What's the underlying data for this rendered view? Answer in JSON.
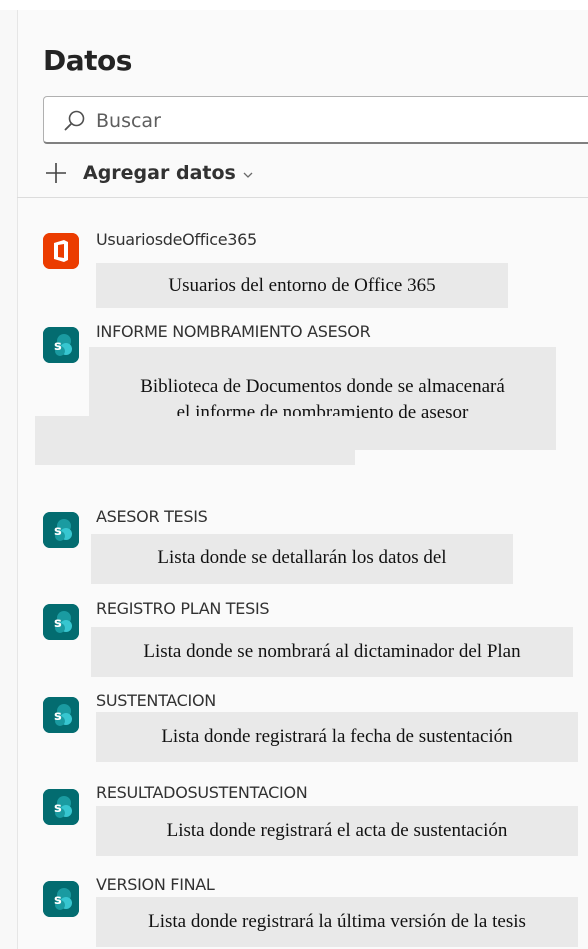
{
  "panel": {
    "title": "Datos",
    "search_placeholder": "Buscar",
    "add_label": "Agregar datos"
  },
  "items": [
    {
      "name": "UsuariosdeOffice365",
      "icon": "office365-icon",
      "description": "Usuarios del entorno de Office 365"
    },
    {
      "name": "INFORME NOMBRAMIENTO ASESOR",
      "icon": "sharepoint-icon",
      "description_lines": [
        "Biblioteca de Documentos donde se almacenará",
        "el informe de nombramiento de asesor"
      ]
    },
    {
      "name": "ASESOR TESIS",
      "icon": "sharepoint-icon",
      "description": "Lista donde se detallarán los datos del"
    },
    {
      "name": "REGISTRO PLAN TESIS",
      "icon": "sharepoint-icon",
      "description": "Lista donde se nombrará al dictaminador del Plan"
    },
    {
      "name": "SUSTENTACION",
      "icon": "sharepoint-icon",
      "description": "Lista donde registrará la fecha de sustentación"
    },
    {
      "name": "RESULTADOSUSTENTACION",
      "icon": "sharepoint-icon",
      "description": "Lista donde registrará el acta de sustentación"
    },
    {
      "name": "VERSION FINAL",
      "icon": "sharepoint-icon",
      "description": "Lista donde registrará la última versión de la tesis"
    }
  ]
}
